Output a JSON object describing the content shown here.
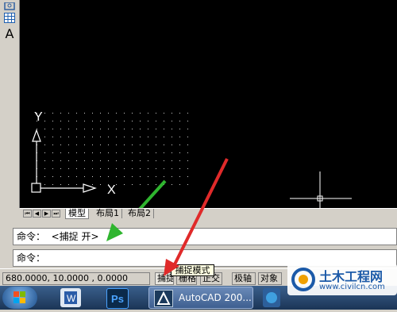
{
  "palette": {
    "text_tool_glyph": "A"
  },
  "canvas": {
    "background": "#000000",
    "ucs_x_label": "X",
    "ucs_y_label": "Y"
  },
  "layout_tabs": [
    "模型",
    "布局1",
    "布局2"
  ],
  "command": {
    "history_line": "命令：  <捕捉 开>",
    "prompt_line": "命令："
  },
  "status_bar": {
    "coordinates": "680.0000, 10.0000 , 0.0000",
    "buttons": [
      "捕捉",
      "栅格",
      "正交",
      "极轴",
      "对象"
    ]
  },
  "tooltip": "捕捉模式",
  "taskbar": {
    "cad_task_label": "AutoCAD 200..."
  },
  "watermark": {
    "title": "土木工程网",
    "url": "www.civilcn.com"
  },
  "arrows": {
    "green": "#2fb52f",
    "red": "#e02a2a"
  }
}
